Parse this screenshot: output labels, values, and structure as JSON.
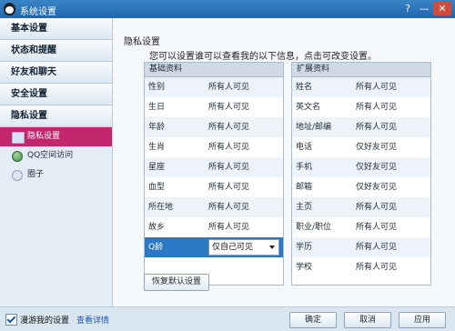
{
  "window": {
    "title": "系统设置",
    "help": "?",
    "minimize": "—",
    "close": "✕"
  },
  "sidebar": {
    "categories": [
      "基本设置",
      "状态和提醒",
      "好友和聊天",
      "安全设置",
      "隐私设置"
    ],
    "sub_items": [
      {
        "label": "隐私设置",
        "icon": "folder-icon",
        "active": true
      },
      {
        "label": "QQ空间访问",
        "icon": "qzone-icon",
        "active": false
      },
      {
        "label": "圈子",
        "icon": "circle-icon",
        "active": false
      }
    ]
  },
  "privacy": {
    "section_title": "隐私设置",
    "description": "您可以设置谁可以查看我的以下信息，点击可改变设置。",
    "basic": {
      "header": "基础资料",
      "rows": [
        {
          "key": "性别",
          "value": "所有人可见"
        },
        {
          "key": "生日",
          "value": "所有人可见"
        },
        {
          "key": "年龄",
          "value": "所有人可见"
        },
        {
          "key": "生肖",
          "value": "所有人可见"
        },
        {
          "key": "星座",
          "value": "所有人可见"
        },
        {
          "key": "血型",
          "value": "所有人可见"
        },
        {
          "key": "所在地",
          "value": "所有人可见"
        },
        {
          "key": "故乡",
          "value": "所有人可见"
        },
        {
          "key": "Q龄",
          "value": "仅自己可见"
        }
      ]
    },
    "extended": {
      "header": "扩展资料",
      "rows": [
        {
          "key": "姓名",
          "value": "所有人可见"
        },
        {
          "key": "英文名",
          "value": "所有人可见"
        },
        {
          "key": "地址/邮编",
          "value": "所有人可见"
        },
        {
          "key": "电话",
          "value": "仅好友可见"
        },
        {
          "key": "手机",
          "value": "仅好友可见"
        },
        {
          "key": "邮箱",
          "value": "仅好友可见"
        },
        {
          "key": "主页",
          "value": "所有人可见"
        },
        {
          "key": "职业/职位",
          "value": "所有人可见"
        },
        {
          "key": "学历",
          "value": "所有人可见"
        },
        {
          "key": "学校",
          "value": "所有人可见"
        }
      ]
    },
    "restore_button": "恢复默认设置"
  },
  "footer": {
    "roaming_label": "漫游我的设置",
    "details_link": "查看详情",
    "ok": "确定",
    "cancel": "取消",
    "apply": "应用"
  }
}
